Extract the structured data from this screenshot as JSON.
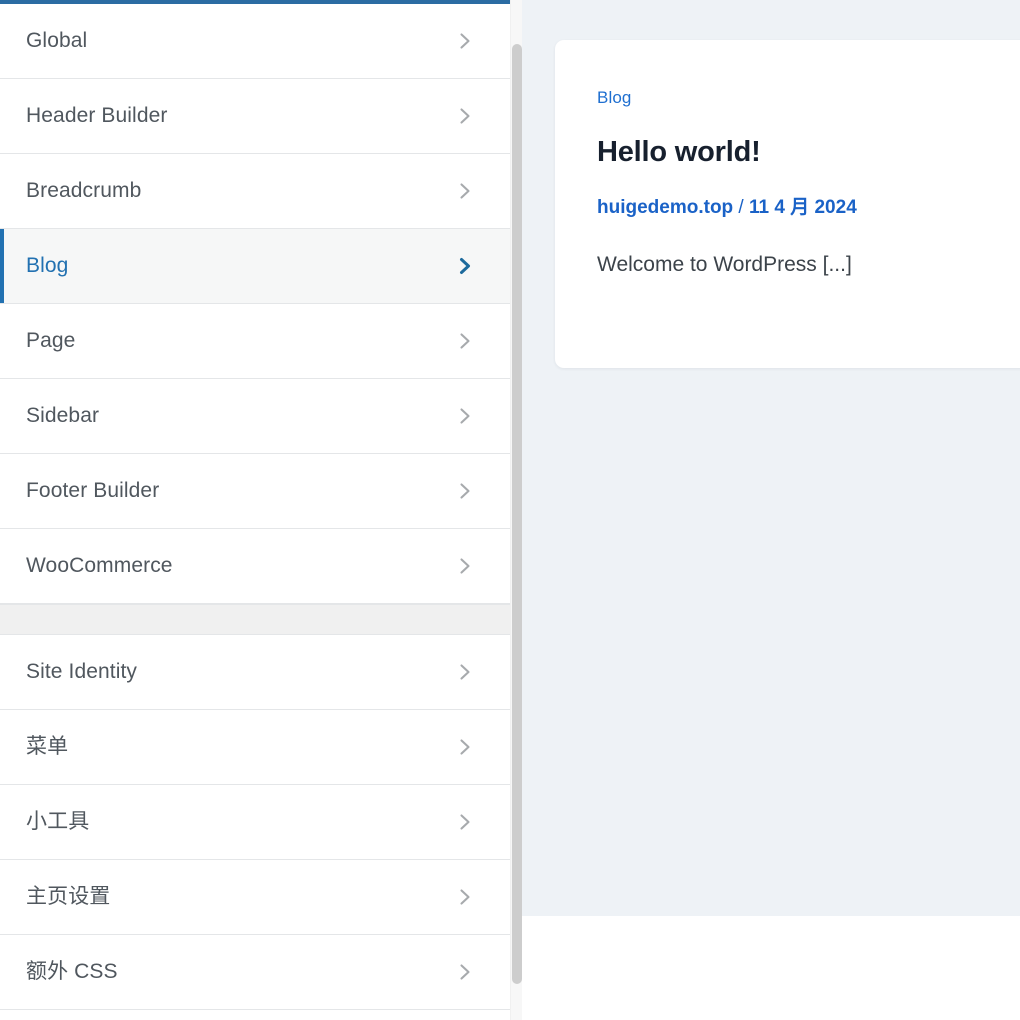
{
  "sidebar": {
    "accent_color": "#2271b1",
    "topbar_color": "#2b6ca3",
    "theme_panels": [
      {
        "label": "Global",
        "icon": "chevron-right-icon",
        "active": false
      },
      {
        "label": "Header Builder",
        "icon": "chevron-right-icon",
        "active": false
      },
      {
        "label": "Breadcrumb",
        "icon": "chevron-right-icon",
        "active": false
      },
      {
        "label": "Blog",
        "icon": "chevron-right-icon",
        "active": true
      },
      {
        "label": "Page",
        "icon": "chevron-right-icon",
        "active": false
      },
      {
        "label": "Sidebar",
        "icon": "chevron-right-icon",
        "active": false
      },
      {
        "label": "Footer Builder",
        "icon": "chevron-right-icon",
        "active": false
      },
      {
        "label": "WooCommerce",
        "icon": "chevron-right-icon",
        "active": false
      }
    ],
    "default_sections": [
      {
        "label": "Site Identity",
        "icon": "chevron-right-icon",
        "active": false
      },
      {
        "label": "菜单",
        "icon": "chevron-right-icon",
        "active": false
      },
      {
        "label": "小工具",
        "icon": "chevron-right-icon",
        "active": false
      },
      {
        "label": "主页设置",
        "icon": "chevron-right-icon",
        "active": false
      },
      {
        "label": "额外 CSS",
        "icon": "chevron-right-icon",
        "active": false
      }
    ],
    "scrollbar": {
      "name": "vertical-scrollbar",
      "thumb_color": "#cdcdcd"
    }
  },
  "preview": {
    "background_color": "#eef2f6",
    "post": {
      "category": "Blog",
      "title": "Hello world!",
      "meta_author": "huigedemo.top",
      "meta_separator": " / ",
      "meta_date": "11 4 月 2024",
      "excerpt": "Welcome to WordPress [...]"
    }
  }
}
